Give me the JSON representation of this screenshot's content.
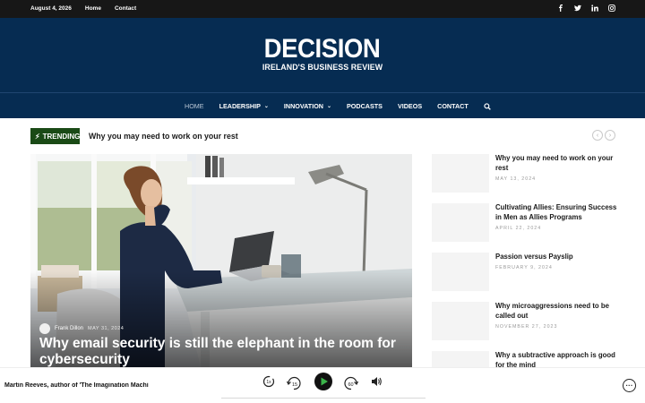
{
  "topbar": {
    "date": "August 4, 2026",
    "links": [
      "Home",
      "Contact"
    ],
    "social_icons": [
      "facebook-icon",
      "twitter-icon",
      "linkedin-icon",
      "instagram-icon"
    ]
  },
  "logo": {
    "main": "DECISION",
    "tagline": "IRELAND'S BUSINESS REVIEW"
  },
  "nav": {
    "items": [
      {
        "label": "HOME",
        "active": true,
        "dropdown": false
      },
      {
        "label": "LEADERSHIP",
        "active": false,
        "dropdown": true
      },
      {
        "label": "INNOVATION",
        "active": false,
        "dropdown": true
      },
      {
        "label": "PODCASTS",
        "active": false,
        "dropdown": false
      },
      {
        "label": "VIDEOS",
        "active": false,
        "dropdown": false
      },
      {
        "label": "CONTACT",
        "active": false,
        "dropdown": false
      }
    ],
    "search_icon": "search-icon"
  },
  "trending": {
    "label": "TRENDING",
    "headline": "Why you may need to work on your rest"
  },
  "hero": {
    "author": "Frank Dillon",
    "date": "MAY 31, 2024",
    "title": "Why email security is still the elephant in the room for cybersecurity"
  },
  "sidebar": {
    "items": [
      {
        "title": "Why you may need to work on your rest",
        "date": "MAY 13, 2024"
      },
      {
        "title": "Cultivating Allies: Ensuring Success in Men as Allies Programs",
        "date": "APRIL 22, 2024"
      },
      {
        "title": "Passion versus Payslip",
        "date": "FEBRUARY 9, 2024"
      },
      {
        "title": "Why microaggressions need to be called out",
        "date": "NOVEMBER 27, 2023"
      },
      {
        "title": "Why a subtractive approach is good for the mind",
        "date": ""
      }
    ]
  },
  "player": {
    "episode_title": "Martin Reeves, author of 'The Imagination Machi",
    "speed": "1x",
    "rewind_seconds": "15",
    "forward_seconds": "60"
  },
  "colors": {
    "header_bg": "#062c52",
    "topbar_bg": "#171717",
    "trending_badge": "#1a4a16"
  }
}
